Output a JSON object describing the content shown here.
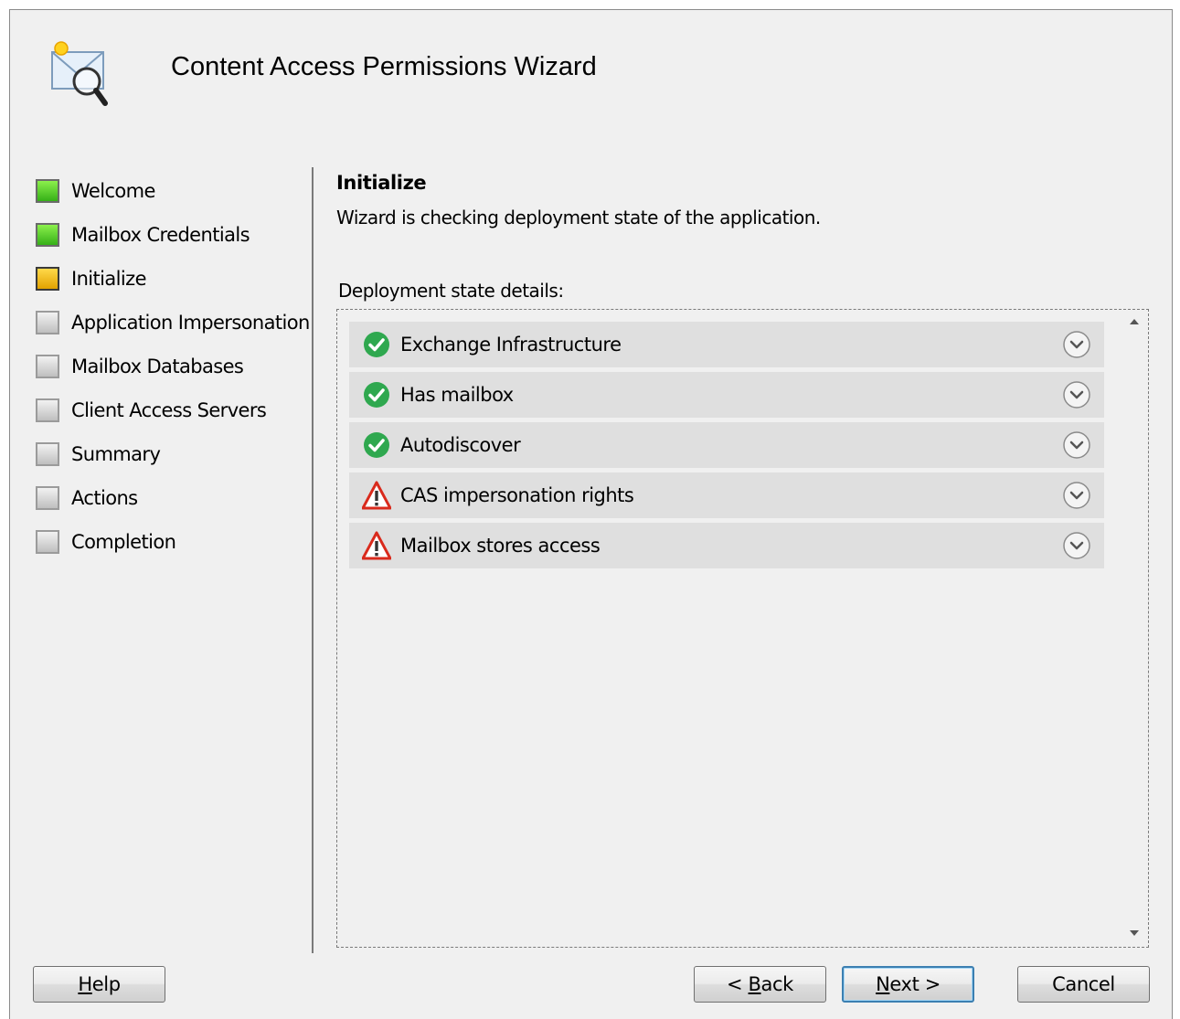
{
  "wizard": {
    "title": "Content Access Permissions Wizard",
    "icon": "envelope-magnifier-icon"
  },
  "steps": [
    {
      "label": "Welcome",
      "status": "done"
    },
    {
      "label": "Mailbox Credentials",
      "status": "done"
    },
    {
      "label": "Initialize",
      "status": "current"
    },
    {
      "label": "Application Impersonation",
      "status": "pending"
    },
    {
      "label": "Mailbox Databases",
      "status": "pending"
    },
    {
      "label": "Client Access Servers",
      "status": "pending"
    },
    {
      "label": "Summary",
      "status": "pending"
    },
    {
      "label": "Actions",
      "status": "pending"
    },
    {
      "label": "Completion",
      "status": "pending"
    }
  ],
  "section": {
    "title": "Initialize",
    "description": "Wizard is checking deployment state of the application.",
    "details_label": "Deployment state details:"
  },
  "details": [
    {
      "label": "Exchange Infrastructure",
      "status": "success"
    },
    {
      "label": "Has mailbox",
      "status": "success"
    },
    {
      "label": "Autodiscover",
      "status": "success"
    },
    {
      "label": "CAS impersonation rights",
      "status": "warning"
    },
    {
      "label": "Mailbox stores access",
      "status": "warning"
    }
  ],
  "buttons": {
    "help": {
      "mnemonic": "H",
      "rest": "elp"
    },
    "back": {
      "prefix": "< ",
      "mnemonic": "B",
      "rest": "ack"
    },
    "next": {
      "mnemonic": "N",
      "rest": "ext >"
    },
    "cancel": {
      "label": "Cancel"
    }
  },
  "colors": {
    "done": "#35b017",
    "current": "#e2a200",
    "pending": "#bfbfbf",
    "success": "#2fa84f",
    "warning": "#d92a1c"
  }
}
